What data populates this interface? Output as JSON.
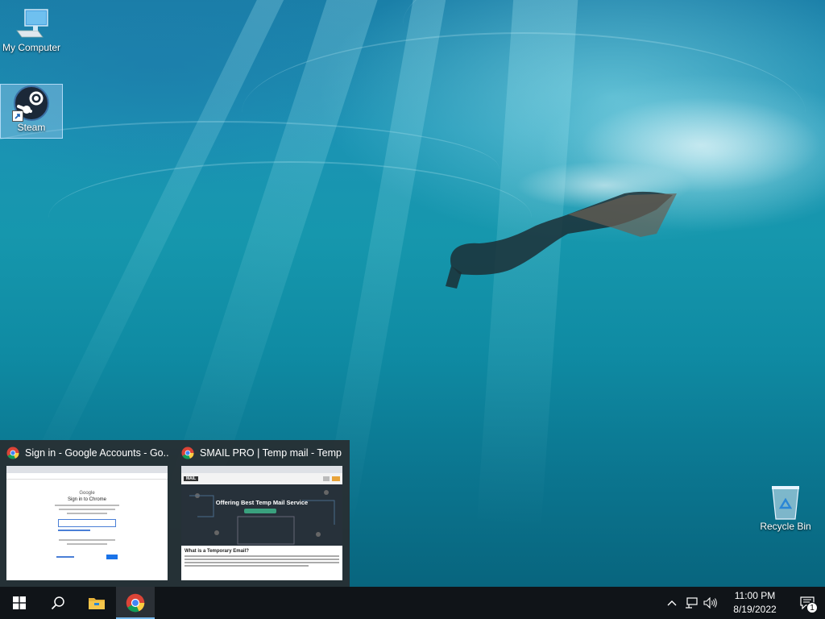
{
  "desktop": {
    "icons": [
      {
        "label": "My Computer",
        "icon": "computer-icon"
      },
      {
        "label": "Steam",
        "icon": "steam-icon",
        "selected": true
      },
      {
        "label": "Recycle Bin",
        "icon": "recycle-bin-icon"
      }
    ]
  },
  "thumbnails": [
    {
      "title": "Sign in - Google Accounts - Go...",
      "icon": "chrome-icon",
      "preview": {
        "brand": "Google",
        "heading": "Sign in to Chrome"
      }
    },
    {
      "title": "SMAIL PRO | Temp mail - Temp ...",
      "icon": "chrome-icon",
      "preview": {
        "logo": "MAIL",
        "hero": "Offering Best Temp Mail Service",
        "section": "What is a Temporary Email?"
      }
    }
  ],
  "taskbar": {
    "buttons": [
      {
        "name": "start",
        "icon": "windows-logo-icon"
      },
      {
        "name": "search",
        "icon": "search-icon"
      },
      {
        "name": "file-explorer",
        "icon": "folder-icon"
      },
      {
        "name": "chrome",
        "icon": "chrome-icon",
        "active": true
      }
    ],
    "tray": {
      "icons": [
        "chevron-up-icon",
        "network-icon",
        "volume-icon"
      ],
      "time": "11:00 PM",
      "date": "8/19/2022",
      "notification_count": "1"
    }
  },
  "colors": {
    "taskbar": "#101418",
    "active_indicator": "#76b9ed",
    "thumbnail_panel": "#2c3034"
  }
}
